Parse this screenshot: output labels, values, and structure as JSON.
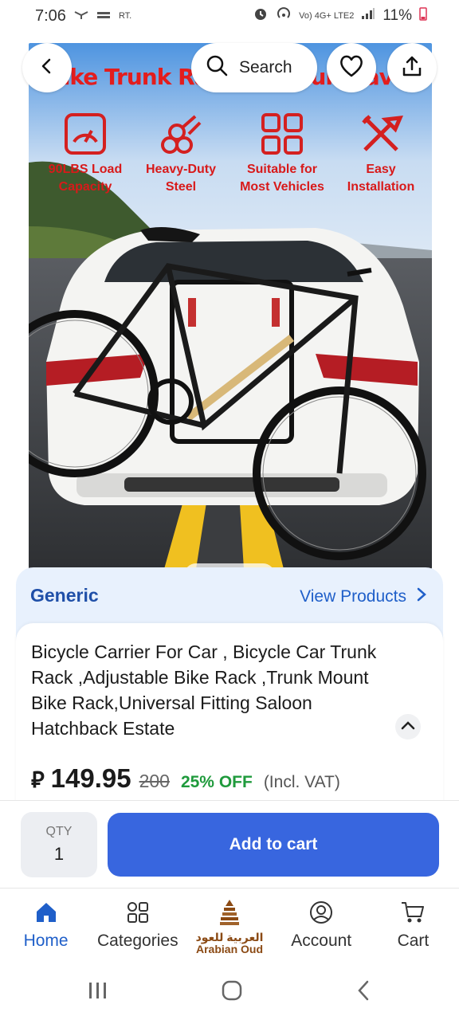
{
  "status_bar": {
    "time": "7:06",
    "carrier_tag": "RT.",
    "network_small": "Vo) 4G+ LTE2",
    "battery": "11%"
  },
  "header": {
    "search_label": "Search"
  },
  "hero": {
    "banner_title": "Bike Trunk Rack for Your Travel",
    "features": [
      {
        "label": "90LBS Load Capacity",
        "icon": "gauge-icon"
      },
      {
        "label": "Heavy-Duty Steel",
        "icon": "steel-pipes-icon"
      },
      {
        "label": "Suitable for Most Vehicles",
        "icon": "grid-icon"
      },
      {
        "label": "Easy Installation",
        "icon": "tools-icon"
      }
    ],
    "carousel_total": 5,
    "carousel_active": 3
  },
  "brand": {
    "name": "Generic",
    "view_products": "View Products"
  },
  "product": {
    "title": "Bicycle Carrier For Car , Bicycle Car Trunk Rack ,Adjustable Bike Rack ,Trunk Mount Bike Rack,Universal Fitting Saloon Hatchback Estate",
    "currency_symbol": "⃁",
    "price": "149.95",
    "old_price": "200",
    "discount": "25% OFF",
    "vat_note": "(Incl. VAT)"
  },
  "cart": {
    "qty_label": "QTY",
    "qty_value": "1",
    "add_to_cart": "Add to cart"
  },
  "tabs": [
    {
      "label": "Home",
      "icon": "home-icon",
      "active": true
    },
    {
      "label": "Categories",
      "icon": "categories-icon",
      "active": false
    },
    {
      "label_ar": "العربية للعود",
      "label_en": "Arabian Oud",
      "icon": "arabian-oud-logo",
      "active": false
    },
    {
      "label": "Account",
      "icon": "account-icon",
      "active": false
    },
    {
      "label": "Cart",
      "icon": "cart-icon",
      "active": false
    }
  ],
  "colors": {
    "accent_blue": "#3866df",
    "brand_text": "#1f4fa8",
    "discount_green": "#1f9a3c",
    "feature_red": "#d81a1a"
  }
}
